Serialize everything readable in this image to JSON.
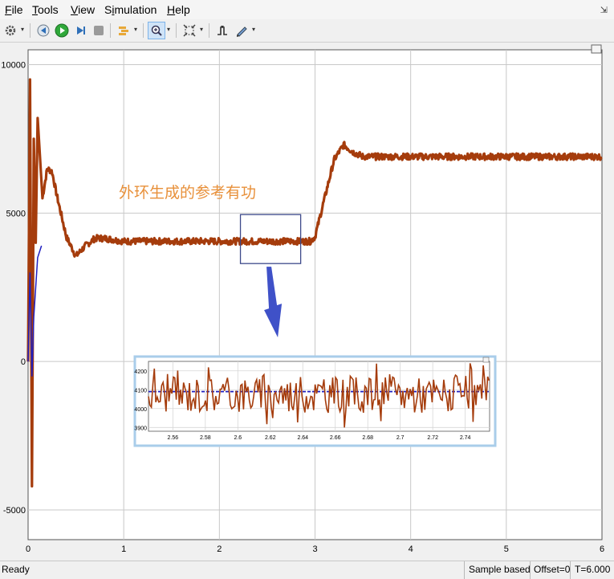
{
  "menu": {
    "file": {
      "acc": "F",
      "rest": "ile"
    },
    "tools": {
      "acc": "T",
      "rest": "ools"
    },
    "view": {
      "acc": "V",
      "rest": "iew"
    },
    "simulation": {
      "pre": "S",
      "acc": "i",
      "rest": "mulation"
    },
    "help": {
      "acc": "H",
      "rest": "elp"
    }
  },
  "icons": [
    "gear-icon",
    "step-back-icon",
    "run-icon",
    "step-forward-icon",
    "stop-icon",
    "highlight-icon",
    "zoom-icon",
    "fit-icon",
    "triggers-icon",
    "style-icon"
  ],
  "annotation": "外环生成的参考有功",
  "colors": {
    "signal": "#a53c0c",
    "reference": "#2020c0",
    "annotation": "#e8903a",
    "zoom_box": "#3d4a8a",
    "arrow": "#3f51c8"
  },
  "chart_data": [
    {
      "type": "line",
      "xlim": [
        0,
        6
      ],
      "ylim": [
        -6000,
        10500
      ],
      "xticks": [
        "0",
        "1",
        "2",
        "3",
        "4",
        "5",
        "6"
      ],
      "yticks": [
        {
          "v": -5000,
          "label": "-5000"
        },
        {
          "v": 0,
          "label": "0"
        },
        {
          "v": 5000,
          "label": "5000"
        },
        {
          "v": 10000,
          "label": "10000"
        }
      ],
      "grid": true,
      "series": [
        {
          "role": "signal",
          "x": [
            0.0,
            0.02,
            0.04,
            0.06,
            0.08,
            0.1,
            0.15,
            0.2,
            0.25,
            0.3,
            0.4,
            0.5,
            0.6,
            0.7,
            0.8,
            1.0,
            1.5,
            2.0,
            2.5,
            2.95,
            3.0,
            3.1,
            3.2,
            3.3,
            3.4,
            3.5,
            3.6,
            4.0,
            5.0,
            6.0
          ],
          "y": [
            0,
            9500,
            -4200,
            7500,
            4000,
            8200,
            5500,
            6500,
            6400,
            5600,
            4200,
            3550,
            3900,
            4150,
            4150,
            4050,
            4050,
            4050,
            4050,
            4050,
            4200,
            5500,
            6800,
            7300,
            7050,
            6900,
            6900,
            6900,
            6900,
            6900
          ]
        },
        {
          "role": "reference",
          "x": [
            0.0,
            0.02,
            0.04,
            0.06,
            0.08,
            0.1,
            0.14
          ],
          "y": [
            0,
            3000,
            -500,
            1500,
            2500,
            3500,
            3900
          ]
        }
      ],
      "zoom_box": {
        "x": [
          2.22,
          2.85
        ],
        "y": [
          3300,
          4950
        ]
      }
    },
    {
      "type": "line",
      "xlim": [
        2.545,
        2.755
      ],
      "ylim": [
        3880,
        4250
      ],
      "xticks": [
        {
          "v": 2.56,
          "label": "2.56"
        },
        {
          "v": 2.58,
          "label": "2.58"
        },
        {
          "v": 2.6,
          "label": "2.6"
        },
        {
          "v": 2.62,
          "label": "2.62"
        },
        {
          "v": 2.64,
          "label": "2.64"
        },
        {
          "v": 2.66,
          "label": "2.66"
        },
        {
          "v": 2.68,
          "label": "2.68"
        },
        {
          "v": 2.7,
          "label": "2.7"
        },
        {
          "v": 2.72,
          "label": "2.72"
        },
        {
          "v": 2.74,
          "label": "2.74"
        }
      ],
      "yticks": [
        {
          "v": 3900,
          "label": "3900"
        },
        {
          "v": 4000,
          "label": "4000"
        },
        {
          "v": 4100,
          "label": "4100"
        },
        {
          "v": 4200,
          "label": "4200"
        }
      ],
      "grid": true,
      "series": [
        {
          "role": "reference",
          "x": [
            2.545,
            2.755
          ],
          "y": [
            4090,
            4090
          ]
        },
        {
          "role": "signal",
          "noise_center": 4075,
          "noise_amp": 140
        }
      ]
    }
  ],
  "status": {
    "ready": "Ready",
    "mode": "Sample based",
    "offset": "Offset=0",
    "time": "T=6.000"
  }
}
